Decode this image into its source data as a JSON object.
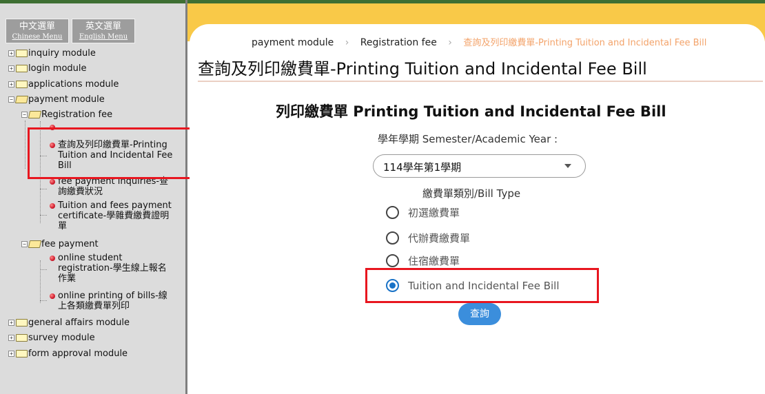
{
  "lang_menu": {
    "chinese": {
      "zh": "中文選單",
      "en": "Chinese Menu"
    },
    "english": {
      "zh": "英文選單",
      "en": "English Menu"
    }
  },
  "tree": {
    "inquiry": "inquiry module",
    "login": "login module",
    "applications": "applications module",
    "payment": "payment module",
    "registration_fee": "Registration fee",
    "item_print": [
      "查詢及列印繳費單-Printing",
      "Tuition and Incidental Fee",
      "Bill"
    ],
    "item_inquiries": [
      "fee payment inquiries-查",
      "詢繳費狀況"
    ],
    "item_certificate": [
      "Tuition and fees payment",
      "certificate-學雜費繳費證明",
      "單"
    ],
    "fee_payment": "fee payment",
    "item_online_reg": [
      "online student",
      "registration-學生線上報名",
      "作業"
    ],
    "item_online_print": [
      "online printing of bills-線",
      "上各類繳費單列印"
    ],
    "general": "general affairs module",
    "survey": "survey module",
    "form_approval": "form approval module"
  },
  "breadcrumb": {
    "b1": "payment module",
    "b2": "Registration fee",
    "b3": "查詢及列印繳費單-Printing Tuition and Incidental Fee Bill",
    "separator": "›"
  },
  "page_title": "查詢及列印繳費單-Printing Tuition and Incidental Fee Bill",
  "form": {
    "heading": "列印繳費單 Printing Tuition and Incidental Fee Bill",
    "semester_label": "學年學期 Semester/Academic Year :",
    "semester_value": "114學年第1學期",
    "bill_type_label": "繳費單類別/Bill Type",
    "options": [
      {
        "label": "初選繳費單",
        "checked": false
      },
      {
        "label": "代辦費繳費單",
        "checked": false
      },
      {
        "label": "住宿繳費單",
        "checked": false
      },
      {
        "label": "Tuition and Incidental Fee Bill",
        "checked": true
      }
    ],
    "query_button": "查詢"
  },
  "colors": {
    "accent_blue": "#3b8edc",
    "highlight_red": "#e8161f",
    "header_yellow": "#f9c948",
    "sidebar_gray": "#dcdcdc"
  }
}
